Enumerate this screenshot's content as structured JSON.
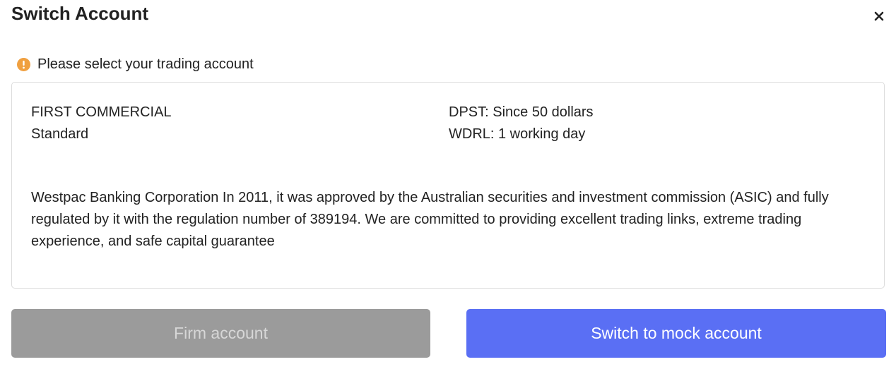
{
  "dialog": {
    "title": "Switch Account",
    "close_icon": "close-icon"
  },
  "notice": {
    "icon": "warning-icon",
    "icon_color": "#f0a040",
    "text": "Please select your trading account"
  },
  "account": {
    "name": "FIRST COMMERCIAL",
    "type": "Standard",
    "deposit": "DPST: Since 50 dollars",
    "withdrawal": "WDRL: 1 working day",
    "description": "Westpac Banking Corporation In 2011, it was approved by the Australian securities and investment commission (ASIC) and fully regulated by it with the regulation number of 389194. We are committed to providing excellent trading links, extreme trading experience, and safe capital guarantee"
  },
  "buttons": {
    "firm_label": "Firm account",
    "mock_label": "Switch to mock account",
    "firm_color": "#9b9b9b",
    "mock_color": "#5a6ff4"
  }
}
